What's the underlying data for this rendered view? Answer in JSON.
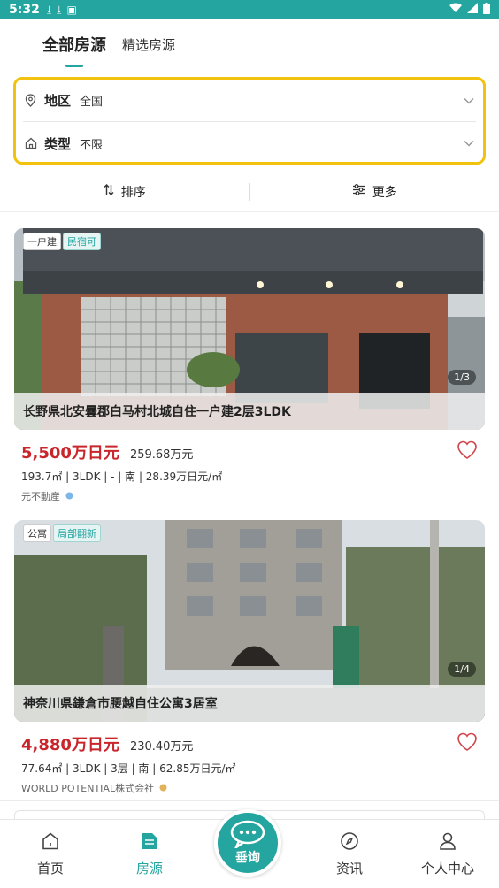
{
  "status": {
    "time": "5:32"
  },
  "tabs": {
    "all": "全部房源",
    "featured": "精选房源"
  },
  "filters": {
    "region_label": "地区",
    "region_value": "全国",
    "type_label": "类型",
    "type_value": "不限"
  },
  "sortbar": {
    "sort_label": "排序",
    "more_label": "更多"
  },
  "listings": [
    {
      "tags": [
        "一户建",
        "民宿可"
      ],
      "photo_count": "1/3",
      "title": "长野県北安曇郡白马村北城自住一户建2层3LDK",
      "price": "5,500万日元",
      "cny": "259.68万元",
      "specs": "193.7㎡ | 3LDK | - | 南 | 28.39万日元/㎡",
      "agent": "元不動産"
    },
    {
      "tags": [
        "公寓",
        "局部翻新"
      ],
      "photo_count": "1/4",
      "title": "神奈川県鎌倉市腰越自住公寓3居室",
      "price": "4,880万日元",
      "cny": "230.40万元",
      "specs": "77.64㎡ | 3LDK | 3层 | 南 | 62.85万日元/㎡",
      "agent": "WORLD POTENTIAL株式会社"
    }
  ],
  "nav": {
    "home": "首页",
    "listings": "房源",
    "consult": "垂询",
    "news": "资讯",
    "profile": "个人中心"
  },
  "colors": {
    "accent": "#24a5a0",
    "price": "#c9262c",
    "highlight": "#f2c20f"
  }
}
